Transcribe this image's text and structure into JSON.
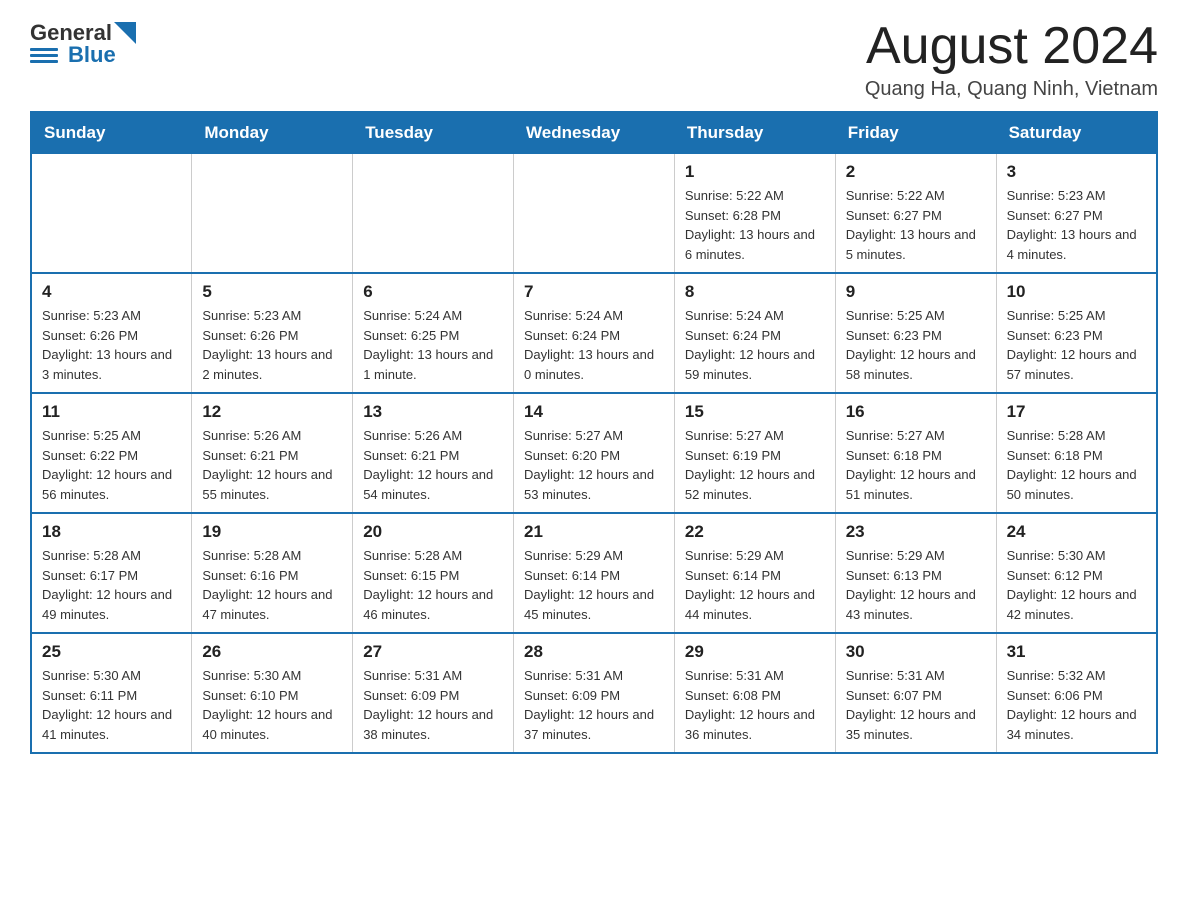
{
  "header": {
    "logo": {
      "general": "General",
      "blue": "Blue"
    },
    "title": "August 2024",
    "location": "Quang Ha, Quang Ninh, Vietnam"
  },
  "calendar": {
    "days_of_week": [
      "Sunday",
      "Monday",
      "Tuesday",
      "Wednesday",
      "Thursday",
      "Friday",
      "Saturday"
    ],
    "weeks": [
      {
        "days": [
          {
            "number": "",
            "info": ""
          },
          {
            "number": "",
            "info": ""
          },
          {
            "number": "",
            "info": ""
          },
          {
            "number": "",
            "info": ""
          },
          {
            "number": "1",
            "info": "Sunrise: 5:22 AM\nSunset: 6:28 PM\nDaylight: 13 hours and 6 minutes."
          },
          {
            "number": "2",
            "info": "Sunrise: 5:22 AM\nSunset: 6:27 PM\nDaylight: 13 hours and 5 minutes."
          },
          {
            "number": "3",
            "info": "Sunrise: 5:23 AM\nSunset: 6:27 PM\nDaylight: 13 hours and 4 minutes."
          }
        ]
      },
      {
        "days": [
          {
            "number": "4",
            "info": "Sunrise: 5:23 AM\nSunset: 6:26 PM\nDaylight: 13 hours and 3 minutes."
          },
          {
            "number": "5",
            "info": "Sunrise: 5:23 AM\nSunset: 6:26 PM\nDaylight: 13 hours and 2 minutes."
          },
          {
            "number": "6",
            "info": "Sunrise: 5:24 AM\nSunset: 6:25 PM\nDaylight: 13 hours and 1 minute."
          },
          {
            "number": "7",
            "info": "Sunrise: 5:24 AM\nSunset: 6:24 PM\nDaylight: 13 hours and 0 minutes."
          },
          {
            "number": "8",
            "info": "Sunrise: 5:24 AM\nSunset: 6:24 PM\nDaylight: 12 hours and 59 minutes."
          },
          {
            "number": "9",
            "info": "Sunrise: 5:25 AM\nSunset: 6:23 PM\nDaylight: 12 hours and 58 minutes."
          },
          {
            "number": "10",
            "info": "Sunrise: 5:25 AM\nSunset: 6:23 PM\nDaylight: 12 hours and 57 minutes."
          }
        ]
      },
      {
        "days": [
          {
            "number": "11",
            "info": "Sunrise: 5:25 AM\nSunset: 6:22 PM\nDaylight: 12 hours and 56 minutes."
          },
          {
            "number": "12",
            "info": "Sunrise: 5:26 AM\nSunset: 6:21 PM\nDaylight: 12 hours and 55 minutes."
          },
          {
            "number": "13",
            "info": "Sunrise: 5:26 AM\nSunset: 6:21 PM\nDaylight: 12 hours and 54 minutes."
          },
          {
            "number": "14",
            "info": "Sunrise: 5:27 AM\nSunset: 6:20 PM\nDaylight: 12 hours and 53 minutes."
          },
          {
            "number": "15",
            "info": "Sunrise: 5:27 AM\nSunset: 6:19 PM\nDaylight: 12 hours and 52 minutes."
          },
          {
            "number": "16",
            "info": "Sunrise: 5:27 AM\nSunset: 6:18 PM\nDaylight: 12 hours and 51 minutes."
          },
          {
            "number": "17",
            "info": "Sunrise: 5:28 AM\nSunset: 6:18 PM\nDaylight: 12 hours and 50 minutes."
          }
        ]
      },
      {
        "days": [
          {
            "number": "18",
            "info": "Sunrise: 5:28 AM\nSunset: 6:17 PM\nDaylight: 12 hours and 49 minutes."
          },
          {
            "number": "19",
            "info": "Sunrise: 5:28 AM\nSunset: 6:16 PM\nDaylight: 12 hours and 47 minutes."
          },
          {
            "number": "20",
            "info": "Sunrise: 5:28 AM\nSunset: 6:15 PM\nDaylight: 12 hours and 46 minutes."
          },
          {
            "number": "21",
            "info": "Sunrise: 5:29 AM\nSunset: 6:14 PM\nDaylight: 12 hours and 45 minutes."
          },
          {
            "number": "22",
            "info": "Sunrise: 5:29 AM\nSunset: 6:14 PM\nDaylight: 12 hours and 44 minutes."
          },
          {
            "number": "23",
            "info": "Sunrise: 5:29 AM\nSunset: 6:13 PM\nDaylight: 12 hours and 43 minutes."
          },
          {
            "number": "24",
            "info": "Sunrise: 5:30 AM\nSunset: 6:12 PM\nDaylight: 12 hours and 42 minutes."
          }
        ]
      },
      {
        "days": [
          {
            "number": "25",
            "info": "Sunrise: 5:30 AM\nSunset: 6:11 PM\nDaylight: 12 hours and 41 minutes."
          },
          {
            "number": "26",
            "info": "Sunrise: 5:30 AM\nSunset: 6:10 PM\nDaylight: 12 hours and 40 minutes."
          },
          {
            "number": "27",
            "info": "Sunrise: 5:31 AM\nSunset: 6:09 PM\nDaylight: 12 hours and 38 minutes."
          },
          {
            "number": "28",
            "info": "Sunrise: 5:31 AM\nSunset: 6:09 PM\nDaylight: 12 hours and 37 minutes."
          },
          {
            "number": "29",
            "info": "Sunrise: 5:31 AM\nSunset: 6:08 PM\nDaylight: 12 hours and 36 minutes."
          },
          {
            "number": "30",
            "info": "Sunrise: 5:31 AM\nSunset: 6:07 PM\nDaylight: 12 hours and 35 minutes."
          },
          {
            "number": "31",
            "info": "Sunrise: 5:32 AM\nSunset: 6:06 PM\nDaylight: 12 hours and 34 minutes."
          }
        ]
      }
    ]
  }
}
